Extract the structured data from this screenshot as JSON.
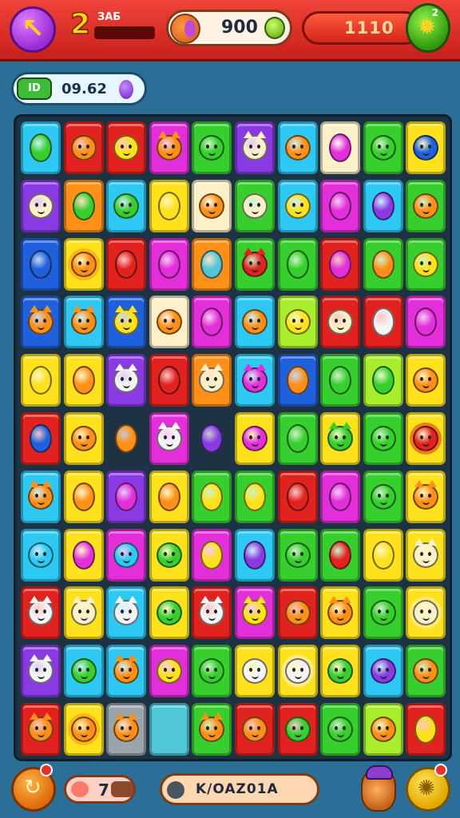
{
  "hud": {
    "back_icon": "arrow-left-icon",
    "lives": "2",
    "lives_caption": "ЗАБ",
    "coins": "900",
    "score": "1110",
    "settings_icon": "gear-icon",
    "settings_badge": "2"
  },
  "level": {
    "badge": "ID",
    "value": "09.62"
  },
  "footer": {
    "moves": "7",
    "label": "K/OAZ01A"
  },
  "colors": {
    "cyan": "#2ec8f5",
    "red": "#e2221e",
    "yellow": "#ffe21b",
    "magenta": "#e32fd9",
    "green": "#37cf2d",
    "purple": "#8a3ae3",
    "orange": "#ff8f16",
    "cream": "#fbf0c8",
    "blue": "#1f61dd",
    "lime": "#a9ee2c",
    "gray": "#9aa4ab",
    "teal": "#4fc7d6"
  },
  "board": {
    "rows": [
      [
        [
          "cyan",
          "green",
          "oval"
        ],
        [
          "red",
          "orange",
          "face"
        ],
        [
          "red",
          "yellow",
          "face"
        ],
        [
          "magenta",
          "orange",
          "cat"
        ],
        [
          "green",
          "green",
          "face"
        ],
        [
          "purple",
          "cream",
          "cat"
        ],
        [
          "cyan",
          "orange",
          "face"
        ],
        [
          "cream",
          "magenta",
          "oval"
        ],
        [
          "green",
          "green",
          "face"
        ],
        [
          "yellow",
          "blue",
          "face"
        ]
      ],
      [
        [
          "purple",
          "cream",
          "face"
        ],
        [
          "orange",
          "green",
          "oval"
        ],
        [
          "cyan",
          "green",
          "face"
        ],
        [
          "yellow",
          "yellow",
          "oval"
        ],
        [
          "cream",
          "orange",
          "face"
        ],
        [
          "green",
          "cream",
          "face"
        ],
        [
          "cyan",
          "yellow",
          "face"
        ],
        [
          "magenta",
          "magenta",
          "oval"
        ],
        [
          "cyan",
          "purple",
          "oval"
        ],
        [
          "green",
          "orange",
          "face"
        ]
      ],
      [
        [
          "blue",
          "blue",
          "oval"
        ],
        [
          "yellow",
          "orange",
          "sun"
        ],
        [
          "red",
          "red",
          "oval"
        ],
        [
          "magenta",
          "magenta",
          "oval"
        ],
        [
          "orange",
          "teal",
          "oval"
        ],
        [
          "green",
          "red",
          "cat"
        ],
        [
          "green",
          "green",
          "oval"
        ],
        [
          "red",
          "magenta",
          "oval"
        ],
        [
          "green",
          "orange",
          "oval"
        ],
        [
          "green",
          "yellow",
          "face"
        ]
      ],
      [
        [
          "blue",
          "orange",
          "cat"
        ],
        [
          "cyan",
          "orange",
          "cat"
        ],
        [
          "blue",
          "yellow",
          "cat"
        ],
        [
          "cream",
          "orange",
          "face"
        ],
        [
          "magenta",
          "magenta",
          "oval"
        ],
        [
          "cyan",
          "orange",
          "face"
        ],
        [
          "lime",
          "yellow",
          "face"
        ],
        [
          "red",
          "cream",
          "face"
        ],
        [
          "red",
          "white",
          "oval"
        ],
        [
          "magenta",
          "magenta",
          "oval"
        ]
      ],
      [
        [
          "yellow",
          "yellow",
          "oval"
        ],
        [
          "yellow",
          "orange",
          "oval"
        ],
        [
          "purple",
          "white",
          "cat"
        ],
        [
          "red",
          "red",
          "oval"
        ],
        [
          "orange",
          "cream",
          "cat"
        ],
        [
          "cyan",
          "magenta",
          "cat"
        ],
        [
          "blue",
          "orange",
          "oval"
        ],
        [
          "green",
          "green",
          "oval"
        ],
        [
          "lime",
          "green",
          "oval"
        ],
        [
          "yellow",
          "orange",
          "face"
        ]
      ],
      [
        [
          "red",
          "blue",
          "oval"
        ],
        [
          "yellow",
          "orange",
          "face"
        ],
        [
          "gap",
          "orange",
          "oval"
        ],
        [
          "magenta",
          "white",
          "cat"
        ],
        [
          "gap",
          "purple",
          "oval"
        ],
        [
          "yellow",
          "magenta",
          "face"
        ],
        [
          "green",
          "green",
          "oval"
        ],
        [
          "yellow",
          "green",
          "cat"
        ],
        [
          "green",
          "green",
          "face"
        ],
        [
          "yellow",
          "red",
          "sun"
        ]
      ],
      [
        [
          "cyan",
          "orange",
          "cat"
        ],
        [
          "yellow",
          "orange",
          "oval"
        ],
        [
          "purple",
          "magenta",
          "oval"
        ],
        [
          "yellow",
          "orange",
          "oval"
        ],
        [
          "green",
          "yellow",
          "oval"
        ],
        [
          "green",
          "yellow",
          "oval"
        ],
        [
          "red",
          "red",
          "oval"
        ],
        [
          "magenta",
          "magenta",
          "oval"
        ],
        [
          "green",
          "green",
          "face"
        ],
        [
          "yellow",
          "orange",
          "cat"
        ]
      ],
      [
        [
          "cyan",
          "cyan",
          "face"
        ],
        [
          "yellow",
          "magenta",
          "oval"
        ],
        [
          "magenta",
          "cyan",
          "face"
        ],
        [
          "yellow",
          "green",
          "face"
        ],
        [
          "magenta",
          "yellow",
          "oval"
        ],
        [
          "cyan",
          "purple",
          "oval"
        ],
        [
          "green",
          "green",
          "face"
        ],
        [
          "green",
          "red",
          "oval"
        ],
        [
          "yellow",
          "yellow",
          "oval"
        ],
        [
          "yellow",
          "cream",
          "cat"
        ]
      ],
      [
        [
          "red",
          "white",
          "cat"
        ],
        [
          "yellow",
          "cream",
          "cat"
        ],
        [
          "cyan",
          "white",
          "cat"
        ],
        [
          "yellow",
          "green",
          "face"
        ],
        [
          "red",
          "white",
          "cat"
        ],
        [
          "magenta",
          "yellow",
          "cat"
        ],
        [
          "red",
          "orange",
          "face"
        ],
        [
          "yellow",
          "orange",
          "cat"
        ],
        [
          "green",
          "green",
          "face"
        ],
        [
          "yellow",
          "cream",
          "sun"
        ]
      ],
      [
        [
          "purple",
          "white",
          "cat"
        ],
        [
          "cyan",
          "green",
          "face"
        ],
        [
          "cyan",
          "orange",
          "cat"
        ],
        [
          "magenta",
          "yellow",
          "face"
        ],
        [
          "green",
          "green",
          "face"
        ],
        [
          "yellow",
          "white",
          "face"
        ],
        [
          "yellow",
          "white",
          "sun"
        ],
        [
          "yellow",
          "green",
          "face"
        ],
        [
          "cyan",
          "purple",
          "face"
        ],
        [
          "green",
          "orange",
          "face"
        ]
      ],
      [
        [
          "red",
          "orange",
          "cat"
        ],
        [
          "yellow",
          "orange",
          "sun"
        ],
        [
          "gray",
          "orange",
          "cat"
        ],
        [
          "teal",
          "none",
          "empty"
        ],
        [
          "green",
          "orange",
          "cat"
        ],
        [
          "red",
          "orange",
          "face"
        ],
        [
          "red",
          "green",
          "face"
        ],
        [
          "green",
          "green",
          "face"
        ],
        [
          "lime",
          "orange",
          "face"
        ],
        [
          "red",
          "yellow",
          "oval"
        ]
      ]
    ]
  }
}
